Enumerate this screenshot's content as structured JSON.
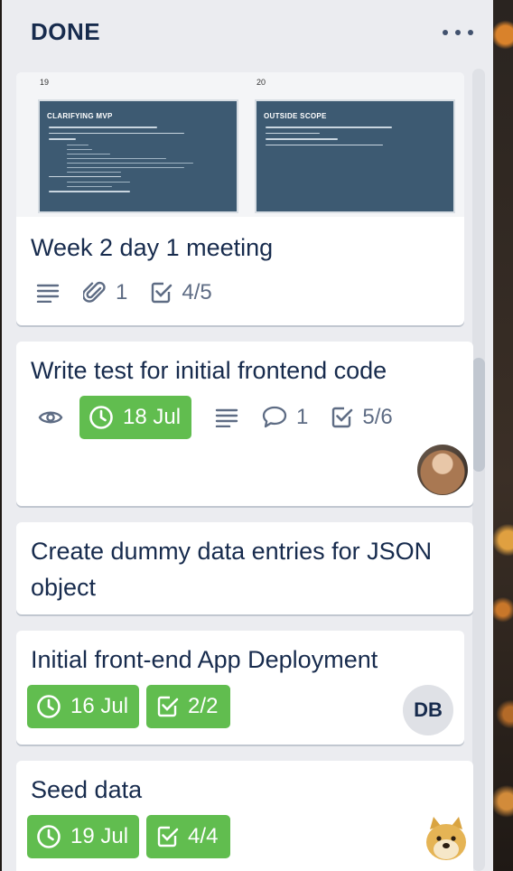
{
  "list": {
    "title": "DONE"
  },
  "cards": [
    {
      "title": "Week 2 day 1 meeting",
      "cover": {
        "slides": [
          {
            "number": "19",
            "title": "CLARIFYING MVP"
          },
          {
            "number": "20",
            "title": "OUTSIDE SCOPE"
          }
        ]
      },
      "badges": {
        "attachments": "1",
        "checklist": "4/5"
      }
    },
    {
      "title": "Write test for initial frontend code",
      "badges": {
        "due": "18 Jul",
        "comments": "1",
        "checklist": "5/6"
      }
    },
    {
      "title": "Create dummy data entries for JSON object"
    },
    {
      "title": "Initial front-end App Deployment",
      "badges": {
        "due": "16 Jul",
        "checklist": "2/2"
      },
      "member_initials": "DB"
    },
    {
      "title": "Seed data",
      "badges": {
        "due": "19 Jul",
        "checklist": "4/4"
      }
    }
  ],
  "colors": {
    "list_bg": "#ebecf0",
    "card_bg": "#ffffff",
    "text": "#172b4d",
    "badge_text": "#5e6c84",
    "due_complete": "#61bd4f"
  },
  "icons": [
    "menu-dots-icon",
    "description-icon",
    "attachment-icon",
    "checklist-icon",
    "watch-icon",
    "clock-icon",
    "comment-icon"
  ]
}
